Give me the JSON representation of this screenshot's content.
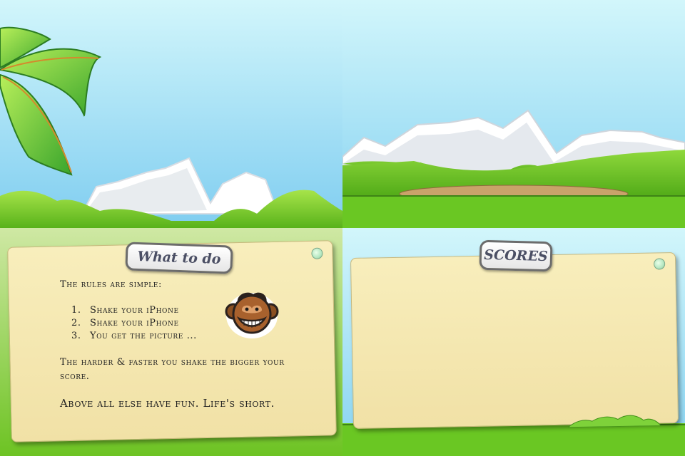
{
  "screen_title_panel": {
    "scene": "palm-tree-mountains"
  },
  "screen_level_panel": {
    "scene": "mountains-clearing"
  },
  "instructions_card": {
    "tab_label": "What to do",
    "intro": "The rules are simple:",
    "steps": [
      {
        "num": "1.",
        "text": "Shake your iPhone"
      },
      {
        "num": "2.",
        "text": "Shake your iPhone"
      },
      {
        "num": "3.",
        "text": "You get the picture ..."
      }
    ],
    "note": "The harder & faster you shake the bigger your score.",
    "closing": "Above all else have fun. Life's short.",
    "mascot": "monkey-face-icon"
  },
  "scores_card": {
    "tab_label": "SCORES"
  },
  "colors": {
    "sky_top": "#d2f6fb",
    "sky_bottom": "#7fcdf0",
    "grass": "#6cc324",
    "card": "#f5e9b1",
    "tab_text": "#4b4f64"
  }
}
